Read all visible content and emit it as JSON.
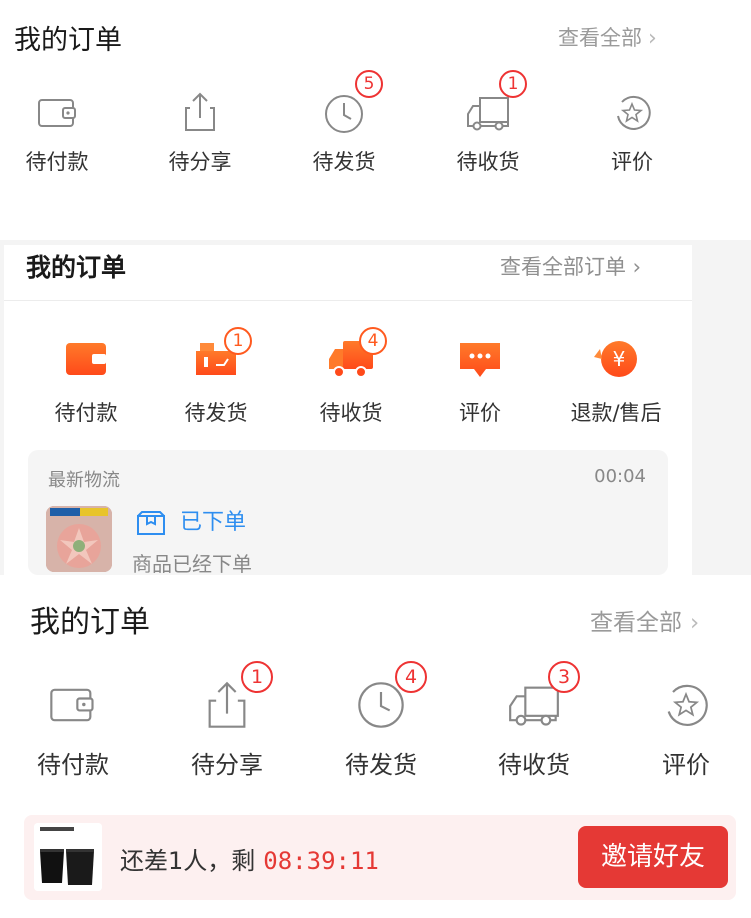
{
  "section1": {
    "title": "我的订单",
    "view_all": "查看全部",
    "items": [
      {
        "label": "待付款",
        "icon": "wallet-icon"
      },
      {
        "label": "待分享",
        "icon": "share-icon"
      },
      {
        "label": "待发货",
        "icon": "clock-icon",
        "badge": "5"
      },
      {
        "label": "待收货",
        "icon": "truck-icon",
        "badge": "1"
      },
      {
        "label": "评价",
        "icon": "star-icon"
      }
    ]
  },
  "section2": {
    "title": "我的订单",
    "view_all": "查看全部订单 ›",
    "items": [
      {
        "label": "待付款",
        "icon": "wallet-icon"
      },
      {
        "label": "待发货",
        "icon": "package-icon",
        "badge": "1"
      },
      {
        "label": "待收货",
        "icon": "truck-icon",
        "badge": "4"
      },
      {
        "label": "评价",
        "icon": "comment-icon"
      },
      {
        "label": "退款/售后",
        "icon": "refund-icon"
      }
    ],
    "logistics": {
      "title": "最新物流",
      "time": "00:04",
      "status": "已下单",
      "desc": "商品已经下单"
    },
    "accent": "#ff5a1f"
  },
  "section3": {
    "title": "我的订单",
    "view_all": "查看全部",
    "items": [
      {
        "label": "待付款",
        "icon": "wallet-icon"
      },
      {
        "label": "待分享",
        "icon": "share-icon",
        "badge": "1"
      },
      {
        "label": "待发货",
        "icon": "clock-icon",
        "badge": "4"
      },
      {
        "label": "待收货",
        "icon": "truck-icon",
        "badge": "3"
      },
      {
        "label": "评价",
        "icon": "star-icon"
      }
    ]
  },
  "invite_bar": {
    "text": "还差1人，剩",
    "timer": "08:39:11",
    "button": "邀请好友",
    "button_color": "#e53935"
  }
}
